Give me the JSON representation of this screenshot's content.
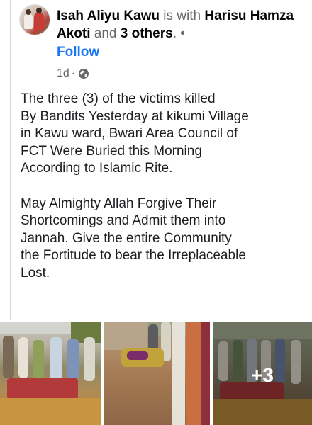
{
  "post": {
    "author": "Isah Aliyu Kawu",
    "with_text": "is with",
    "tagged": "Harisu Hamza Akoti",
    "and_text": "and",
    "others": "3 others",
    "period": ".",
    "separator": "•",
    "follow_label": "Follow",
    "time": "1d",
    "time_separator": "·",
    "privacy_icon": "globe-icon",
    "paragraphs": [
      "The three (3) of the victims killed\nBy Bandits Yesterday at kikumi Village\nin Kawu ward, Bwari Area Council of\nFCT Were Buried this Morning\nAccording to Islamic Rite.",
      "May Almighty Allah Forgive Their\nShortcomings and Admit them into\nJannah. Give the entire Community\nthe Fortitude to bear the Irreplaceable\nLost."
    ],
    "more_photos": "+3"
  },
  "colors": {
    "link": "#1877f2",
    "text": "#1c1e21",
    "muted": "#65676b"
  }
}
